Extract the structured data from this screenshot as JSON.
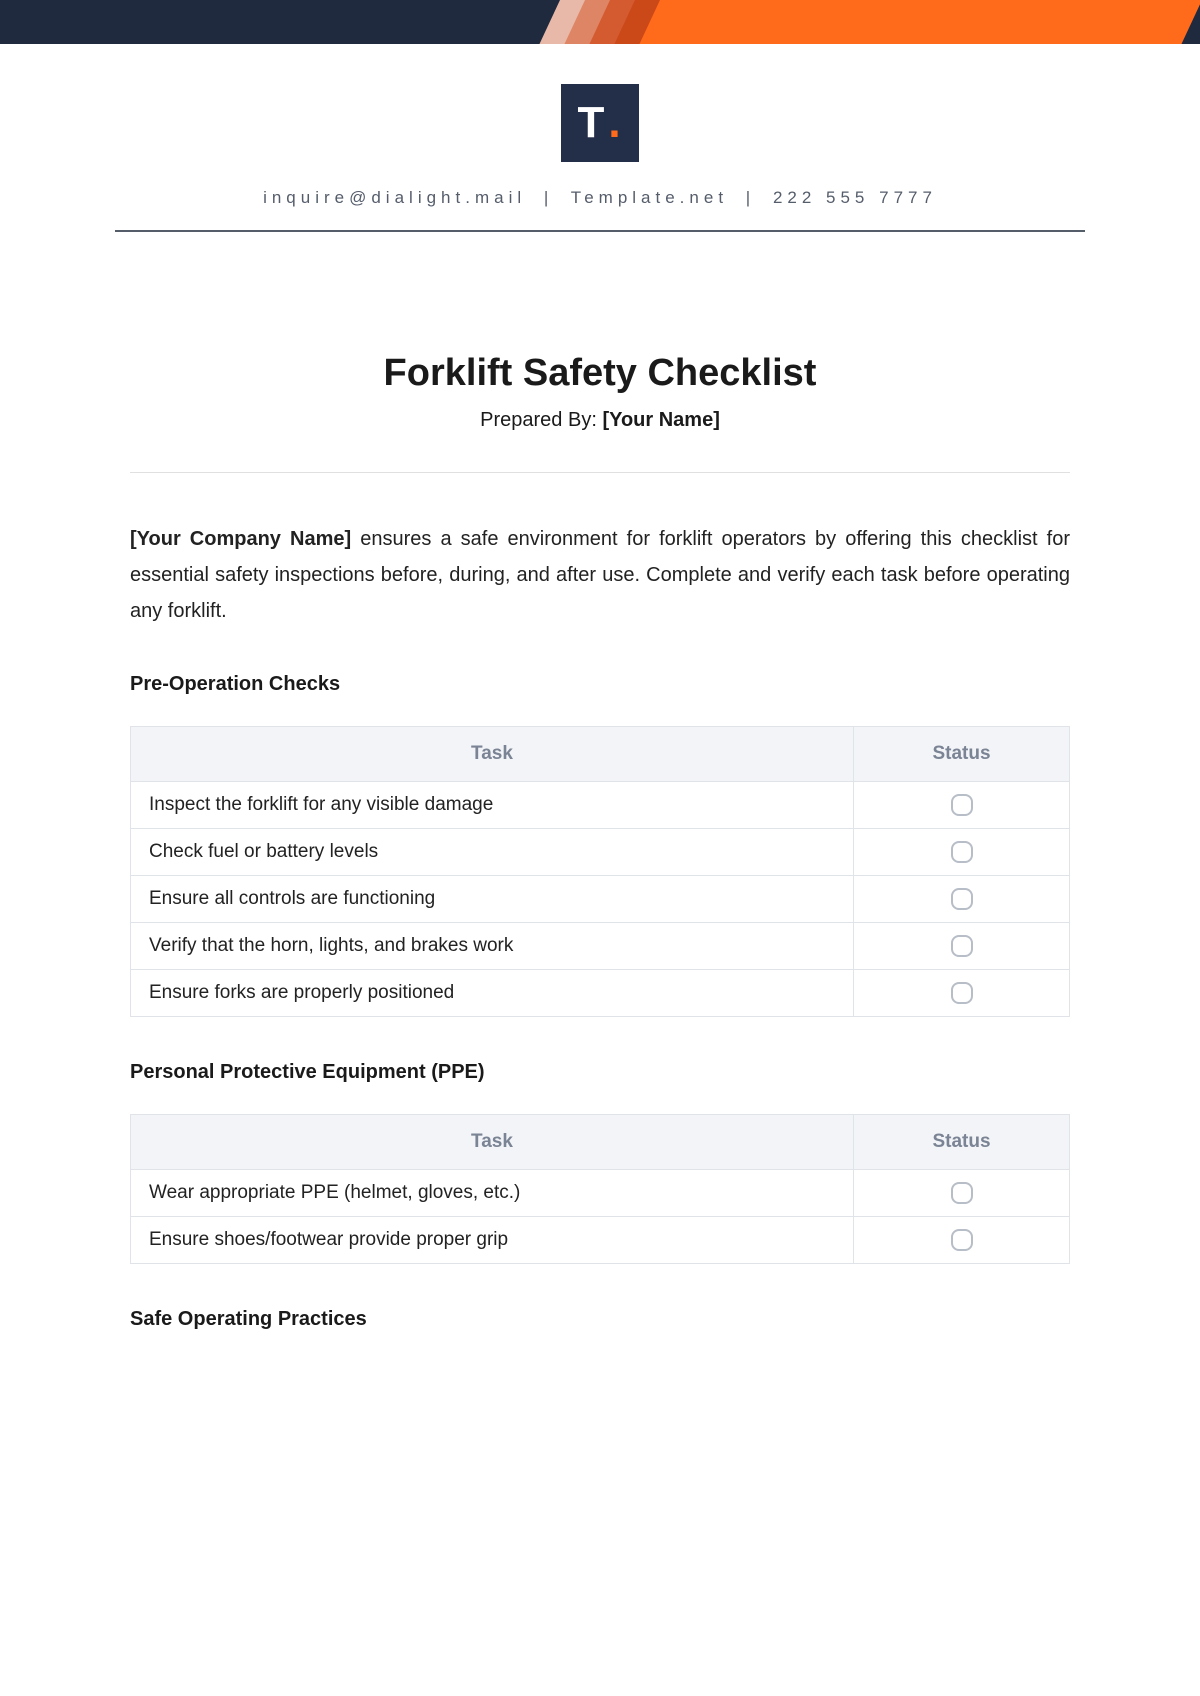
{
  "logo_text": "T",
  "contact": {
    "email": "inquire@dialight.mail",
    "site": "Template.net",
    "phone": "222 555 7777"
  },
  "title": "Forklift Safety Checklist",
  "prepared_label": "Prepared By:",
  "prepared_placeholder": "[Your Name]",
  "intro_placeholder": "[Your Company Name]",
  "intro_rest": " ensures a safe environment for forklift operators by offering this checklist for essential safety inspections before, during, and after use. Complete and verify each task before operating any forklift.",
  "col_task": "Task",
  "col_status": "Status",
  "sections": [
    {
      "heading": "Pre-Operation Checks",
      "tasks": [
        "Inspect the forklift for any visible damage",
        "Check fuel or battery levels",
        "Ensure all controls are functioning",
        "Verify that the horn, lights, and brakes work",
        "Ensure forks are properly positioned"
      ]
    },
    {
      "heading": "Personal Protective Equipment (PPE)",
      "tasks": [
        "Wear appropriate PPE (helmet, gloves, etc.)",
        "Ensure shoes/footwear provide proper grip"
      ]
    },
    {
      "heading": "Safe Operating Practices",
      "tasks": []
    }
  ]
}
